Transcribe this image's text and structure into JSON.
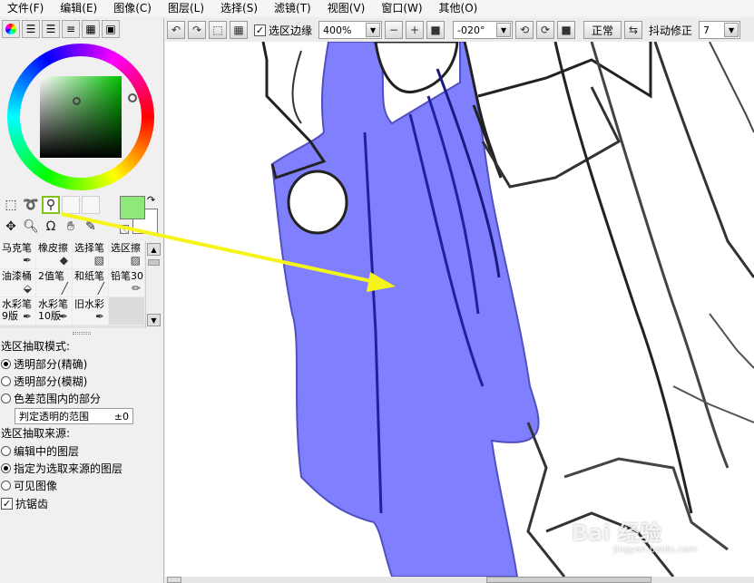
{
  "menubar": {
    "items": [
      "文件(F)",
      "编辑(E)",
      "图像(C)",
      "图层(L)",
      "选择(S)",
      "滤镜(T)",
      "视图(V)",
      "窗口(W)",
      "其他(O)"
    ]
  },
  "toolbar": {
    "select_edge_label": "选区边缘",
    "zoom_value": "400%",
    "rotation_value": "-020°",
    "blend_mode": "正常",
    "stabilizer_label": "抖动修正",
    "stabilizer_value": "7"
  },
  "brushes": [
    {
      "label": "马克笔"
    },
    {
      "label": "橡皮擦"
    },
    {
      "label": "选择笔"
    },
    {
      "label": "选区擦"
    },
    {
      "label": "油漆桶"
    },
    {
      "label": "2值笔"
    },
    {
      "label": "和纸笔"
    },
    {
      "label": "铅笔30"
    },
    {
      "label": "水彩笔\n9版"
    },
    {
      "label": "水彩笔\n10版"
    },
    {
      "label": "旧水彩"
    }
  ],
  "options": {
    "extract_mode_title": "选区抽取模式:",
    "mode_opt1": "透明部分(精确)",
    "mode_opt2": "透明部分(模糊)",
    "mode_opt3": "色差范围内的部分",
    "range_label": "判定透明的范围",
    "range_value": "±0",
    "source_title": "选区抽取来源:",
    "src_opt1": "编辑中的图层",
    "src_opt2": "指定为选取来源的图层",
    "src_opt3": "可见图像",
    "antialias_label": "抗锯齿"
  },
  "colors": {
    "selection_fill": "#8080ff",
    "foreground": "#8ee87a",
    "highlight": "#7fc31c",
    "arrow": "#f5f51a"
  },
  "watermark": {
    "brand": "Bai 经验",
    "url": "jingyan.baidu.com"
  }
}
